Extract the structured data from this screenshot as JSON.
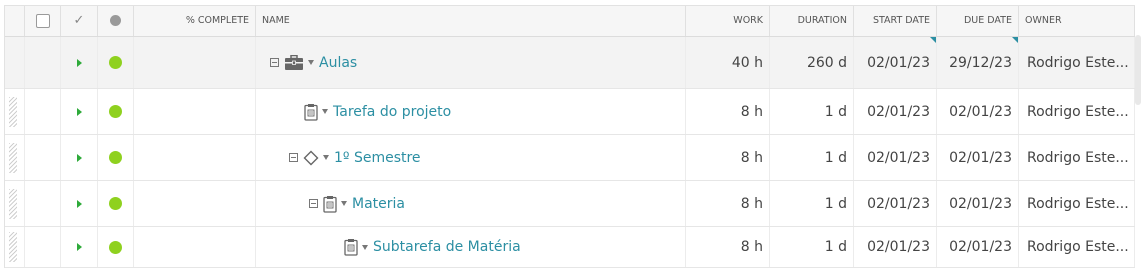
{
  "header": {
    "complete_label": "% COMPLETE",
    "name_label": "NAME",
    "work_label": "WORK",
    "duration_label": "DURATION",
    "start_label": "START DATE",
    "due_label": "DUE DATE",
    "owner_label": "OWNER",
    "done_glyph": "✓"
  },
  "icons": {
    "expand": "collapse-minus-icon",
    "portfolio": "briefcase-icon",
    "task": "clipboard-icon",
    "milestone": "diamond-icon"
  },
  "colors": {
    "status": "#8fd11f",
    "link": "#2c8fa3",
    "arrow": "#2eaa3a"
  },
  "rows": [
    {
      "name": "Aulas",
      "work": "40 h",
      "duration": "260 d",
      "start": "02/01/23",
      "due": "29/12/23",
      "owner": "Rodrigo Este..."
    },
    {
      "name": "Tarefa do projeto",
      "work": "8 h",
      "duration": "1 d",
      "start": "02/01/23",
      "due": "02/01/23",
      "owner": "Rodrigo Este..."
    },
    {
      "name": "1º Semestre",
      "work": "8 h",
      "duration": "1 d",
      "start": "02/01/23",
      "due": "02/01/23",
      "owner": "Rodrigo Este..."
    },
    {
      "name": "Materia",
      "work": "8 h",
      "duration": "1 d",
      "start": "02/01/23",
      "due": "02/01/23",
      "owner": "Rodrigo Este..."
    },
    {
      "name": "Subtarefa de Matéria",
      "work": "8 h",
      "duration": "1 d",
      "start": "02/01/23",
      "due": "02/01/23",
      "owner": "Rodrigo Este..."
    }
  ]
}
